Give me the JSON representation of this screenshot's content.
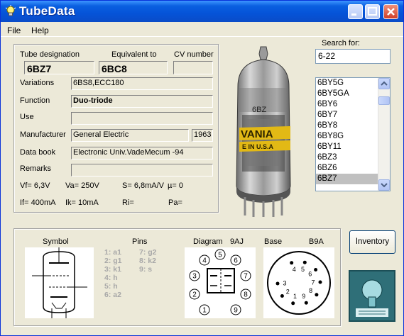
{
  "window": {
    "title": "TubeData"
  },
  "menu": {
    "file": "File",
    "help": "Help"
  },
  "tube": {
    "designation_label": "Tube designation",
    "designation": "6BZ7",
    "equivalent_label": "Equivalent to",
    "equivalent": "6BC8",
    "cv_label": "CV number",
    "cv": "",
    "variations_label": "Variations",
    "variations": "6BS8,ECC180",
    "function_label": "Function",
    "function": "Duo-triode",
    "use_label": "Use",
    "use": "",
    "manufacturer_label": "Manufacturer",
    "manufacturer": "General Electric",
    "year": "1963",
    "databook_label": "Data book",
    "databook": "Electronic Univ.VadeMecum -94",
    "remarks_label": "Remarks",
    "remarks": "",
    "vf": "Vf= 6,3V",
    "va": "Va= 250V",
    "s": "S= 6,8mA/V",
    "mu": "µ= 0",
    "if": "If= 400mA",
    "ik": "Ik= 10mA",
    "ri": "Ri=",
    "pa": "Pa="
  },
  "photo": {
    "text_brand": "VANIA",
    "text_country": "E IN U.S.A",
    "text_type": "6BZ"
  },
  "search": {
    "label": "Search for:",
    "value": "6-22",
    "items": [
      "6BY5G",
      "6BY5GA",
      "6BY6",
      "6BY7",
      "6BY8",
      "6BY8G",
      "6BY11",
      "6BZ3",
      "6BZ6",
      "6BZ7"
    ],
    "selected_index": 9
  },
  "bottom": {
    "symbol_label": "Symbol",
    "pins_label": "Pins",
    "pins_left": [
      "1: a1",
      "2: g1",
      "3: k1",
      "4: h",
      "5: h",
      "6: a2"
    ],
    "pins_right": [
      "7: g2",
      "8: k2",
      "9: s"
    ],
    "diagram_label": "Diagram",
    "diagram_code": "9AJ",
    "base_label": "Base",
    "base_code": "B9A",
    "diagram_pins": [
      "1",
      "2",
      "3",
      "4",
      "5",
      "6",
      "7",
      "8",
      "9"
    ],
    "base_numbers": [
      "4",
      "5",
      "6",
      "7",
      "8",
      "9",
      "1",
      "2",
      "3"
    ]
  },
  "buttons": {
    "inventory": "Inventory"
  },
  "colors": {
    "title_bar": "#0a5fe0",
    "selected_row": "#c0c0c0",
    "pins_text": "#a8a8a8"
  }
}
